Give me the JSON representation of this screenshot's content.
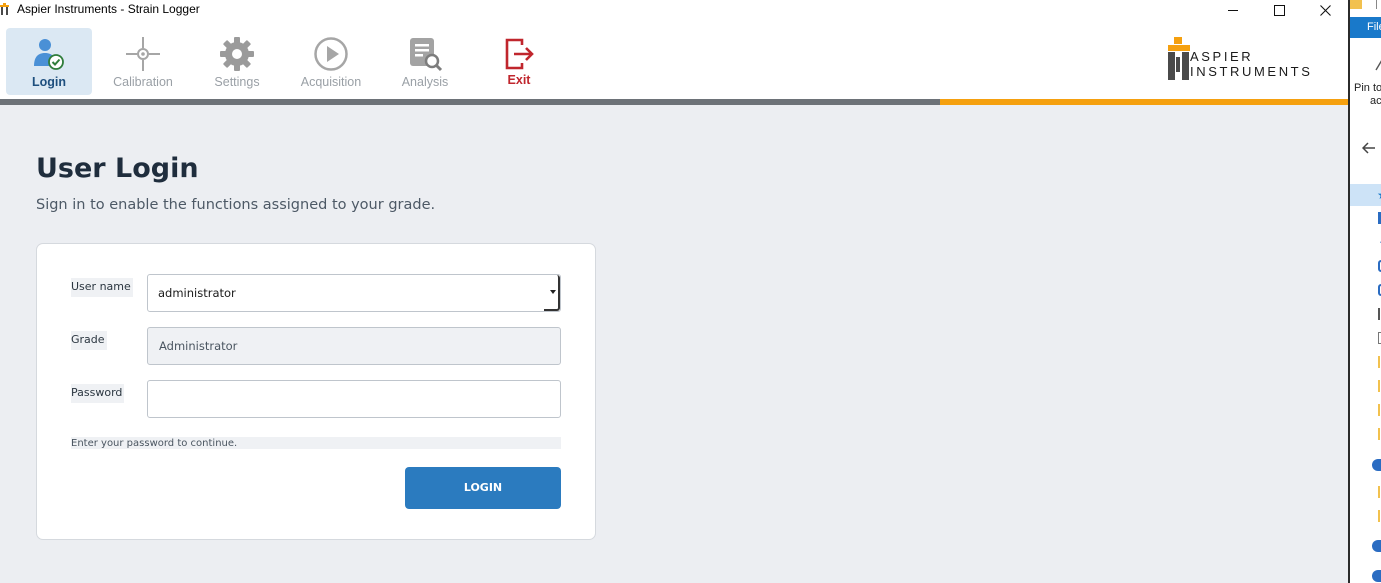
{
  "window": {
    "title": "Aspier Instruments - Strain Logger"
  },
  "toolbar": {
    "items": [
      {
        "label": "Login",
        "icon": "user-check-icon",
        "state": "active"
      },
      {
        "label": "Calibration",
        "icon": "crosshair-icon",
        "state": "disabled"
      },
      {
        "label": "Settings",
        "icon": "gear-icon",
        "state": "disabled"
      },
      {
        "label": "Acquisition",
        "icon": "play-circle-icon",
        "state": "disabled"
      },
      {
        "label": "Analysis",
        "icon": "document-search-icon",
        "state": "disabled"
      },
      {
        "label": "Exit",
        "icon": "exit-arrow-icon",
        "state": "enabled"
      }
    ]
  },
  "brand": {
    "line1": "ASPIER",
    "line2": "INSTRUMENTS"
  },
  "colors": {
    "accent": "#f5a00f",
    "primary": "#2b7bbf",
    "exit": "#c0262d",
    "active_tab_bg": "#dbe8f3"
  },
  "page": {
    "title": "User Login",
    "subtitle": "Sign in to enable the functions assigned to your grade."
  },
  "form": {
    "username_label": "User name",
    "username_value": "administrator",
    "grade_label": "Grade",
    "grade_value": "Administrator",
    "password_label": "Password",
    "password_value": "",
    "hint": "Enter your password to continue.",
    "login_button": "LOGIN"
  },
  "side_window": {
    "ribbon_tab": "File",
    "pin_text_line1": "Pin to",
    "pin_text_line2": "ac"
  }
}
